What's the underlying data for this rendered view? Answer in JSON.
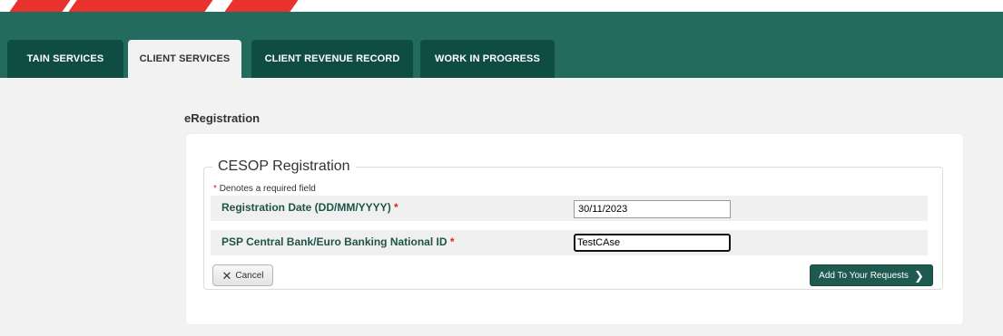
{
  "nav": {
    "tabs": [
      {
        "label": "TAIN SERVICES",
        "active": false
      },
      {
        "label": "CLIENT SERVICES",
        "active": true
      },
      {
        "label": "CLIENT REVENUE RECORD",
        "active": false
      },
      {
        "label": "WORK IN PROGRESS",
        "active": false
      }
    ]
  },
  "page": {
    "title": "eRegistration"
  },
  "form": {
    "legend": "CESOP Registration",
    "required_star": "*",
    "required_note": "Denotes a required field",
    "fields": [
      {
        "label": "Registration Date (DD/MM/YYYY)",
        "value": "30/11/2023"
      },
      {
        "label": "PSP Central Bank/Euro Banking National ID",
        "value": "TestCAse"
      }
    ],
    "cancel_label": "Cancel",
    "cancel_icon": "close-icon",
    "submit_label": "Add To Your Requests",
    "submit_icon": "chevron-right-icon"
  },
  "colors": {
    "nav_bar": "#246b5f",
    "tab": "#0f4d43",
    "accent_red": "#d9232d",
    "field_label": "#1f5449",
    "primary_button": "#1f5a4f"
  }
}
